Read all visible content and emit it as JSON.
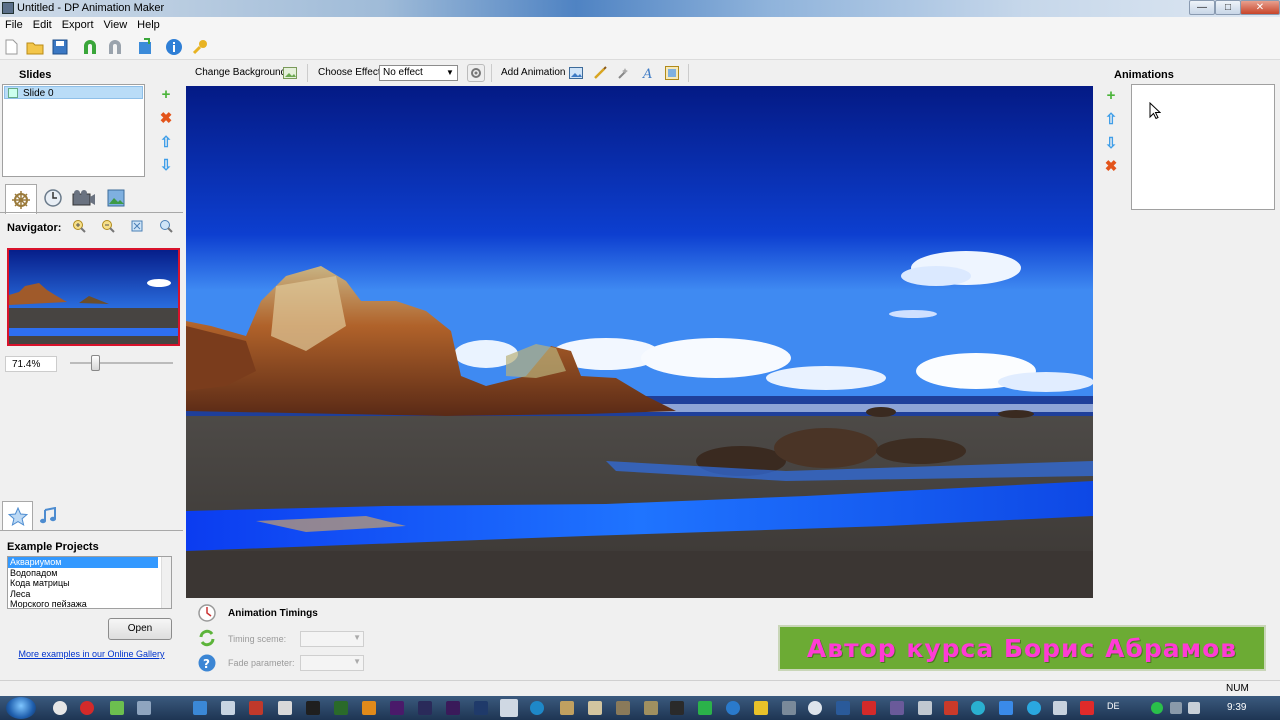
{
  "window": {
    "title": "Untitled - DP Animation Maker",
    "minimize": "—",
    "maximize": "□",
    "close": "✕"
  },
  "menu": [
    "File",
    "Edit",
    "Export",
    "View",
    "Help"
  ],
  "slides_panel": {
    "title": "Slides",
    "items": [
      {
        "label": "Slide 0"
      }
    ],
    "add": "+",
    "remove": "✖",
    "up": "⇧",
    "down": "⇩"
  },
  "navigator": {
    "label": "Navigator:",
    "zoom_value": "71.4%",
    "zoom_level_fraction": 0.2
  },
  "example_projects": {
    "title": "Example Projects",
    "items": [
      "Аквариумом",
      "Водопадом",
      "Кода матрицы",
      "Леса",
      "Морского пейзажа"
    ],
    "selected_index": 0,
    "open_button": "Open",
    "gallery_link": "More examples in our Online Gallery"
  },
  "editor_toolbar": {
    "change_background": "Change Background",
    "choose_effect": "Choose Effect:",
    "effect_value": "No effect",
    "add_animation": "Add Animation"
  },
  "timings": {
    "title": "Animation Timings",
    "timing_scene_label": "Timing sceme:",
    "fade_parameter_label": "Fade parameter:"
  },
  "animations_panel": {
    "title": "Animations",
    "add": "+",
    "remove": "✖",
    "up": "⇧",
    "down": "⇩"
  },
  "banner": {
    "text": "Автор курса Борис Абрамов"
  },
  "statusbar": {
    "num": "NUM"
  },
  "taskbar": {
    "lang": "DE",
    "clock": "9:39"
  },
  "colors": {
    "accent_selection": "#3399ff",
    "banner_bg": "#6cab34",
    "banner_text": "#ff3bd5",
    "nav_border": "#d8122b"
  }
}
